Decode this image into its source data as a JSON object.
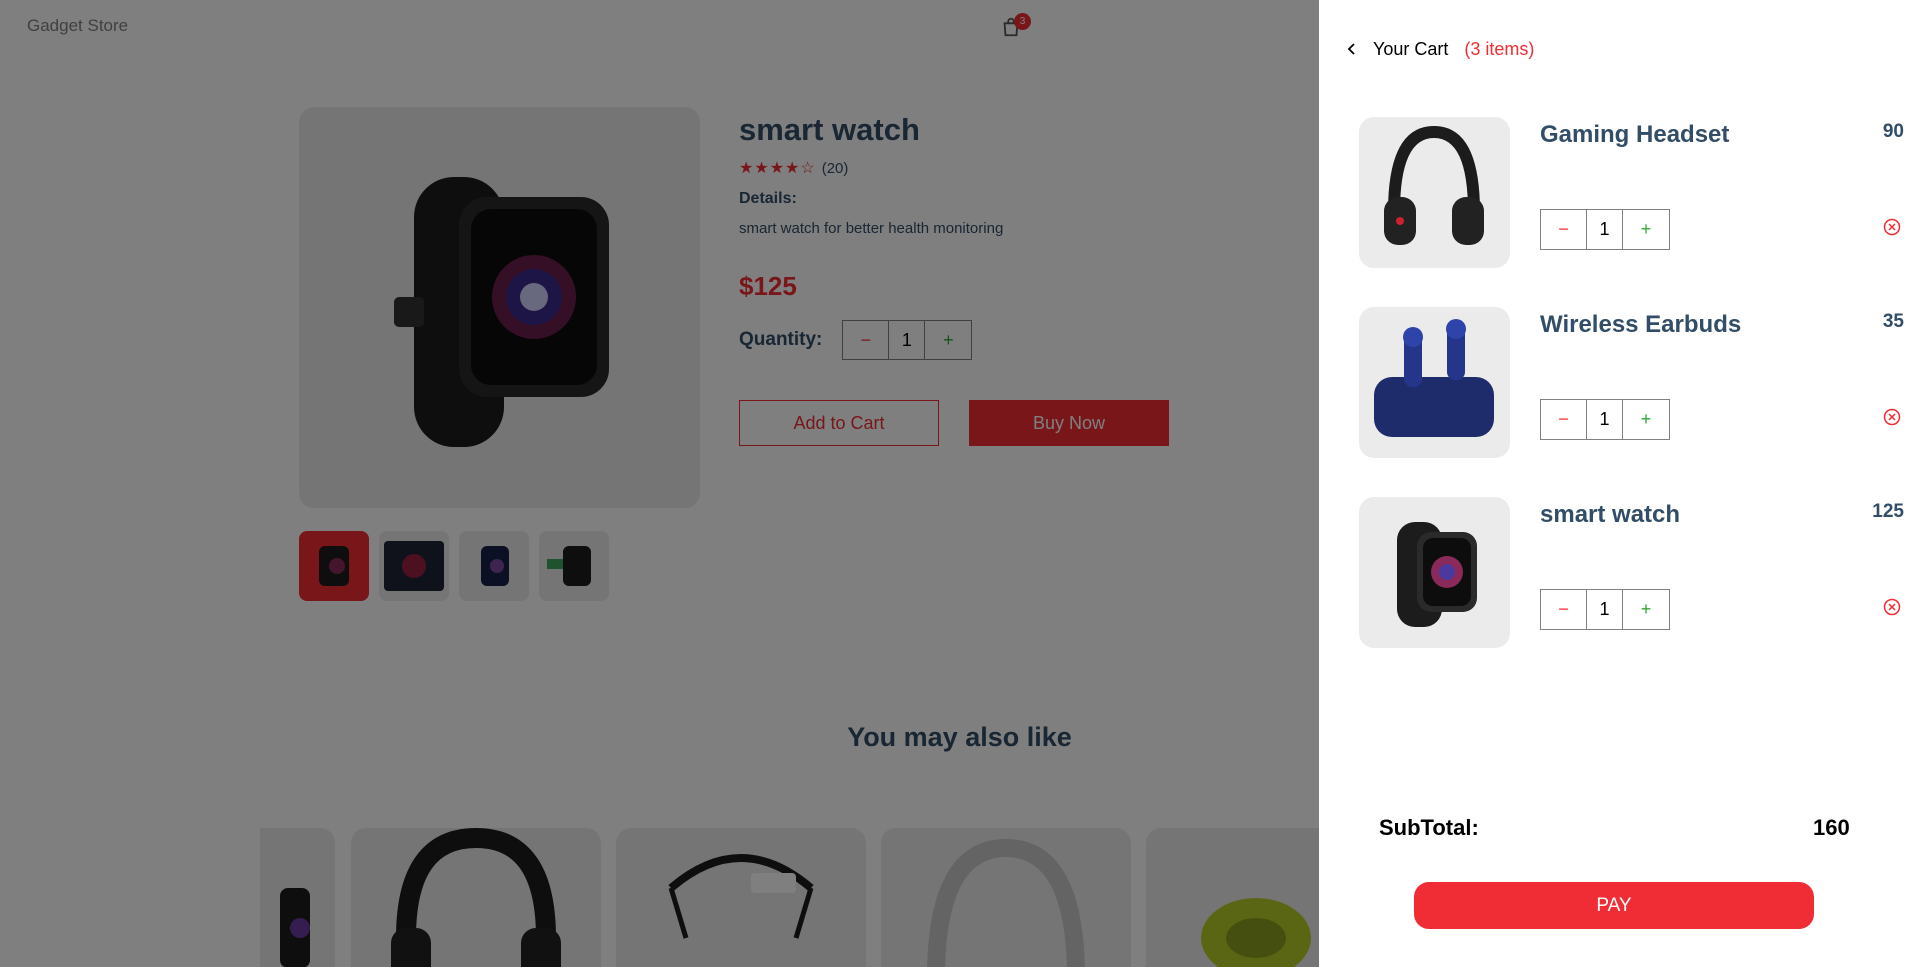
{
  "navbar": {
    "logo": "Gadget Store",
    "cart_icon": "shopping-bag-icon",
    "cart_count": "3"
  },
  "product": {
    "title": "smart watch",
    "stars": "★★★★☆",
    "rating_value": 4,
    "review_count": "(20)",
    "details_label": "Details:",
    "details_text": "smart watch for better health monitoring",
    "price": "$125",
    "quantity_label": "Quantity:",
    "quantity": "1",
    "minus": "−",
    "plus": "+",
    "add_to_cart": "Add to Cart",
    "buy_now": "Buy Now"
  },
  "may_also_like": {
    "title": "You may also like"
  },
  "cart": {
    "title": "Your Cart",
    "count_text": "(3 items)",
    "items": [
      {
        "name": "Gaming Headset",
        "price": "90",
        "quantity": "1",
        "image": "headset"
      },
      {
        "name": "Wireless Earbuds",
        "price": "35",
        "quantity": "1",
        "image": "earbuds"
      },
      {
        "name": "smart watch",
        "price": "125",
        "quantity": "1",
        "image": "watch"
      }
    ],
    "minus": "−",
    "plus": "+",
    "subtotal_label": "SubTotal:",
    "subtotal_value": "160",
    "pay_label": "PAY"
  },
  "colors": {
    "accent": "#f02d34",
    "heading": "#324d67",
    "plus": "#31a831"
  }
}
